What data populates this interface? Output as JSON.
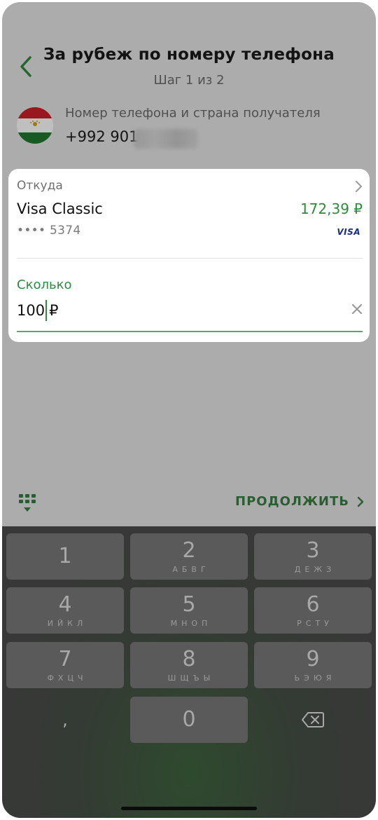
{
  "header": {
    "title": "За рубеж по номеру телефона",
    "subtitle": "Шаг 1 из 2"
  },
  "recipient": {
    "label": "Номер телефона и страна получателя",
    "phone_visible": "+992 901",
    "flag_icon": "tajikistan-flag-icon"
  },
  "source": {
    "label": "Откуда",
    "card_name": "Visa Classic",
    "balance": "172,39 ₽",
    "card_number": "•••• 5374",
    "brand": "VISA"
  },
  "amount": {
    "label": "Сколько",
    "value": "100",
    "currency": "₽"
  },
  "actions": {
    "continue_label": "ПРОДОЛЖИТЬ"
  },
  "keyboard": {
    "keys": [
      {
        "digit": "1",
        "letters": ""
      },
      {
        "digit": "2",
        "letters": "АБВГ"
      },
      {
        "digit": "3",
        "letters": "ДЕЖЗ"
      },
      {
        "digit": "4",
        "letters": "ИЙКЛ"
      },
      {
        "digit": "5",
        "letters": "МНОП"
      },
      {
        "digit": "6",
        "letters": "РСТУ"
      },
      {
        "digit": "7",
        "letters": "ФХЦЧ"
      },
      {
        "digit": "8",
        "letters": "ШЩЪЫ"
      },
      {
        "digit": "9",
        "letters": "ЬЭЮЯ"
      },
      {
        "digit": ",",
        "letters": ""
      },
      {
        "digit": "0",
        "letters": ""
      }
    ]
  },
  "colors": {
    "accent_green": "#2e8a3c",
    "dark_green": "#2a5e32",
    "visa_blue": "#1a2a8c"
  }
}
